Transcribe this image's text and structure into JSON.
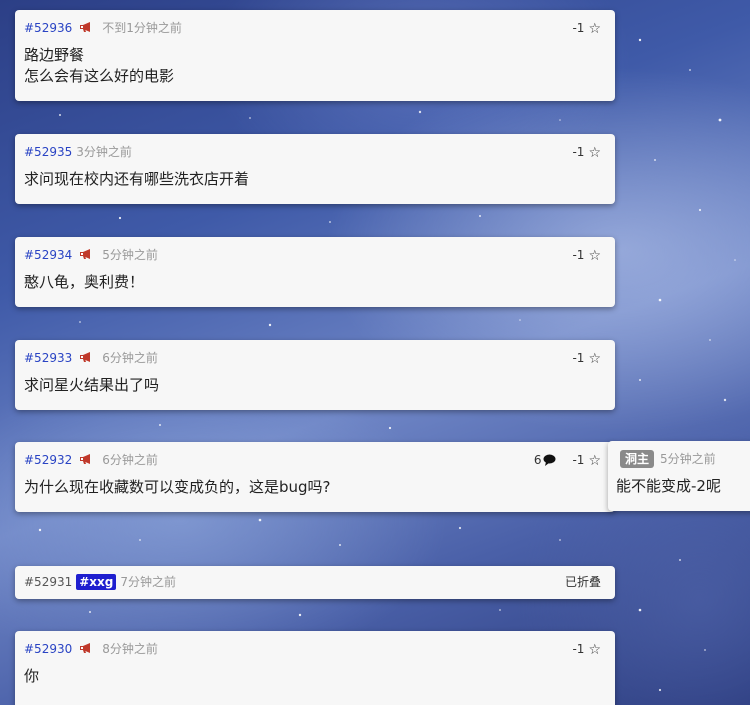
{
  "posts": [
    {
      "id": "#52936",
      "time": "不到1分钟之前",
      "likes": "-1",
      "text": "路边野餐\n怎么会有这么好的电影"
    },
    {
      "id": "#52935",
      "time": "3分钟之前",
      "likes": "-1",
      "text": "求问现在校内还有哪些洗衣店开着"
    },
    {
      "id": "#52934",
      "time": "5分钟之前",
      "likes": "-1",
      "text": "憨八龟，奥利费！"
    },
    {
      "id": "#52933",
      "time": "6分钟之前",
      "likes": "-1",
      "text": "求问星火结果出了吗"
    },
    {
      "id": "#52932",
      "time": "6分钟之前",
      "likes": "-1",
      "replies": "6",
      "text": "为什么现在收藏数可以变成负的，这是bug吗?"
    },
    {
      "id": "#52931",
      "tag": "#xxg",
      "time": "7分钟之前",
      "status": "已折叠"
    },
    {
      "id": "#52930",
      "time": "8分钟之前",
      "likes": "-1",
      "text": "你"
    }
  ],
  "reply": {
    "badge": "洞主",
    "time": "5分钟之前",
    "text": "能不能变成-2呢"
  },
  "icons": {
    "megaphone": "megaphone-icon",
    "star": "star-outline-icon",
    "bubble": "speech-bubble-icon"
  },
  "colors": {
    "post_id": "#2a44c4",
    "tag_bg": "#1f1fcf",
    "megaphone": "#c0392b",
    "badge_bg": "#8a8a8a"
  }
}
